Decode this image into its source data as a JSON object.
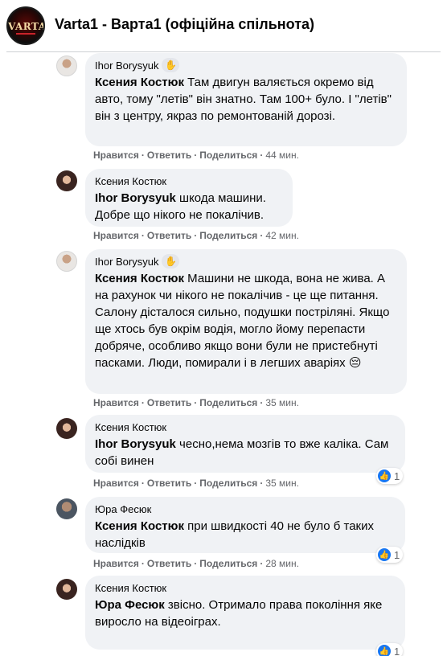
{
  "group": {
    "title": "Varta1 - Варта1 (офіційна спільнота)",
    "logo_text": "VARTA1"
  },
  "labels": {
    "like": "Нравится",
    "reply": "Ответить",
    "share": "Поделиться",
    "separator": "·"
  },
  "comments": [
    {
      "author": "Ihor Borysyuk",
      "badge_icon": "waving-hand-icon",
      "mention": "Ксения Костюк",
      "text": " Там двигун валяється окремо від авто, тому \"летів\" він знатно. Там 100+ було. І \"летів\" він з центру, якраз по ремонтованій дорозі.",
      "time": "44 мин."
    },
    {
      "author": "Ксения Костюк",
      "mention": "Ihor Borysyuk",
      "text": " шкода машини. Добре що нікого не покалічив.",
      "time": "42 мин."
    },
    {
      "author": "Ihor Borysyuk",
      "badge_icon": "waving-hand-icon",
      "mention": "Ксения Костюк",
      "text": " Машини не шкода, вона не жива. А на рахунок чи нікого не покалічив - це ще питання. Салону дісталося сильно, подушки постріляні. Якщо ще хтось був окрім водія, могло йому перепасти добряче, особливо якщо вони були не пристебнуті пасками. Люди, помирали і в легших аваріях 😔",
      "time": "35 мин."
    },
    {
      "author": "Ксения Костюк",
      "mention": "Ihor Borysyuk",
      "text": " чесно,нема мозгів то вже каліка. Сам собі винен",
      "time": "35 мин.",
      "reactions": 1
    },
    {
      "author": "Юра Фесюк",
      "mention": "Ксения Костюк",
      "text": " при швидкості 40 не було б таких наслідків",
      "time": "28 мин.",
      "reactions": 1
    },
    {
      "author": "Ксения Костюк",
      "mention": "Юра Фесюк",
      "text": " звісно. Отримало права покоління яке виросло на відеоіграх.",
      "reactions": 1
    }
  ]
}
